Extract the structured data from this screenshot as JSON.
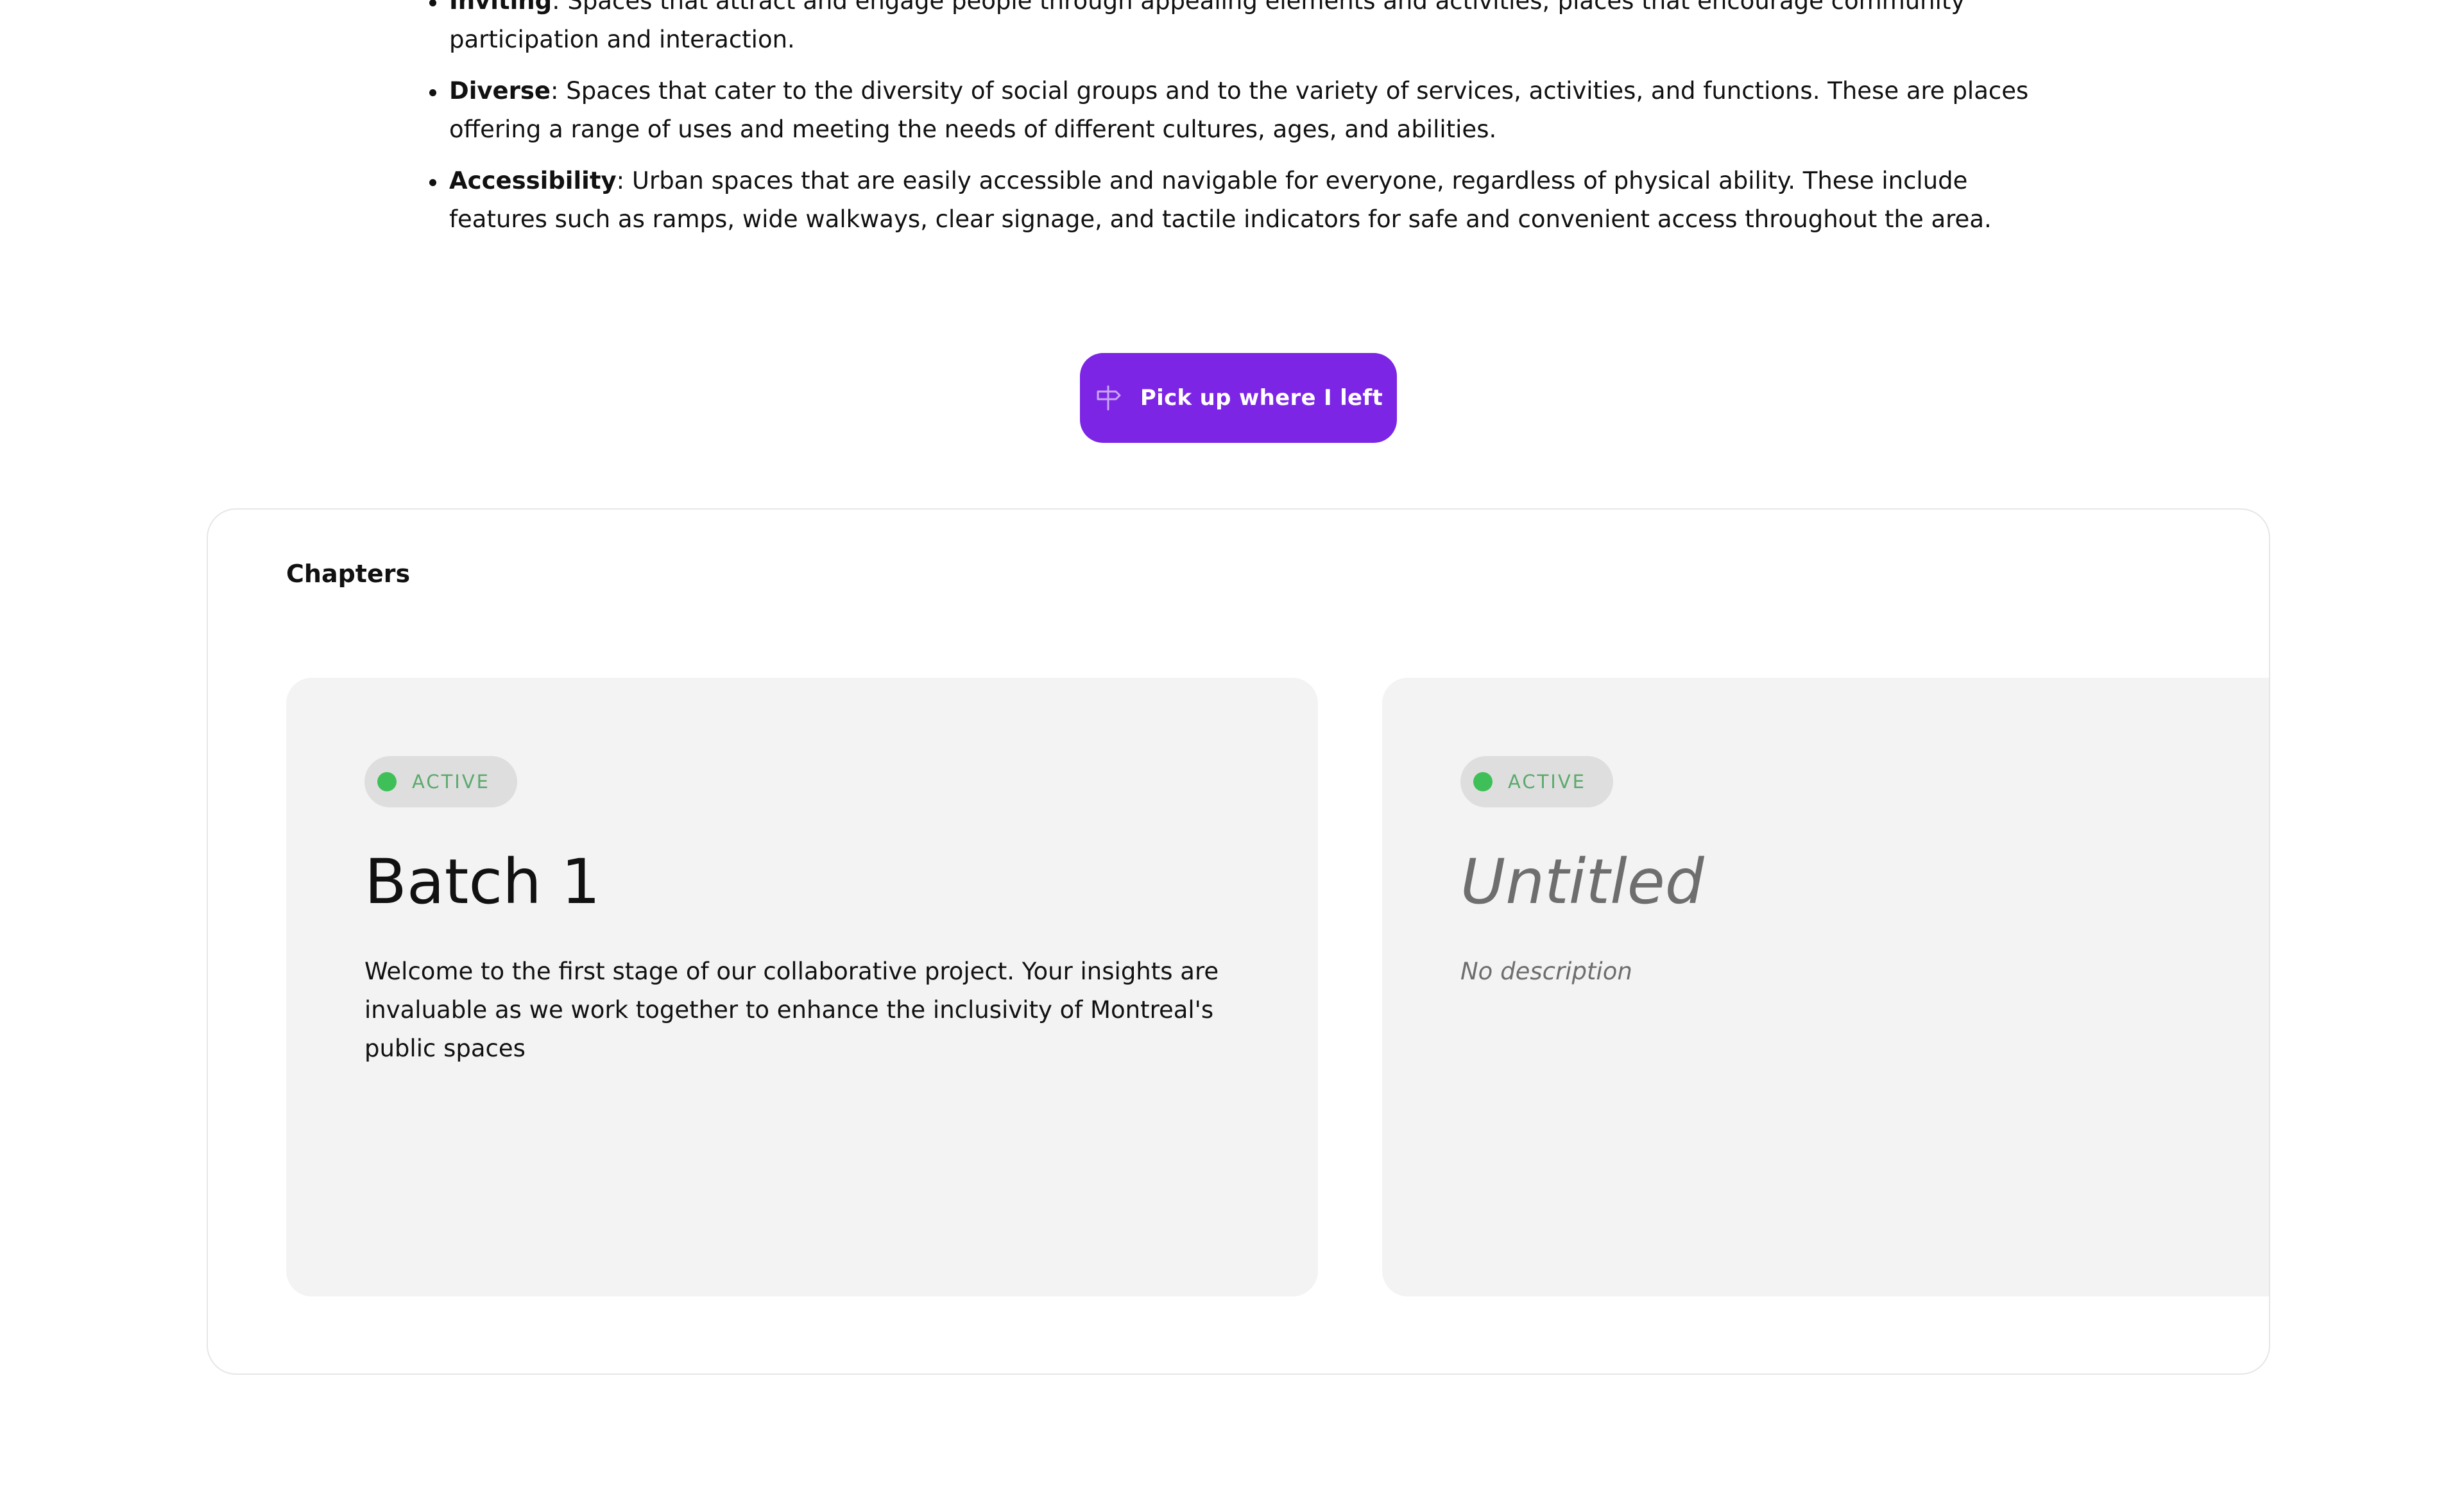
{
  "principles": [
    {
      "term": "Inviting",
      "description": ": Spaces that attract and engage people through appealing elements and activities; places that encourage community participation and interaction."
    },
    {
      "term": "Diverse",
      "description": ": Spaces that cater to the diversity of social groups and to the variety of services, activities, and functions. These are places offering a range of uses and meeting the needs of different cultures, ages, and abilities."
    },
    {
      "term": "Accessibility",
      "description": ": Urban spaces that are easily accessible and navigable for everyone, regardless of physical ability. These include features such as ramps, wide walkways, clear signage, and tactile indicators for safe and convenient access throughout the area."
    }
  ],
  "resume_button": {
    "label": "Pick up where I left",
    "icon": "signpost-icon"
  },
  "chapters": {
    "heading": "Chapters",
    "items": [
      {
        "status": "ACTIVE",
        "title": "Batch 1",
        "description": "Welcome to the first stage of our collaborative project. Your insights are invaluable as we work together to enhance the inclusivity of Montreal's public spaces"
      },
      {
        "status": "ACTIVE",
        "title": "Untitled",
        "description": "No description"
      }
    ]
  },
  "colors": {
    "accent": "#7c25e4",
    "status_active": "#3fbf58",
    "card_background": "#f3f3f3"
  }
}
